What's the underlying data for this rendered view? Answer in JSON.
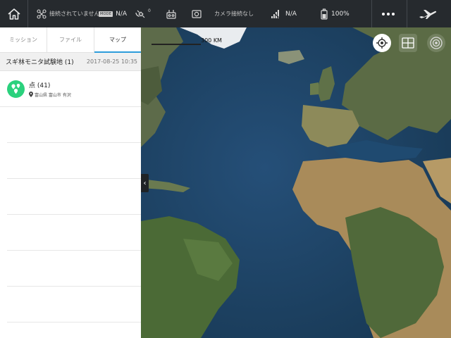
{
  "topbar": {
    "aircraft_status": "接続されていません",
    "flight_mode": "N/A",
    "mode_badge": "MODE",
    "gps_count": "0",
    "camera_status": "カメラ接続なし",
    "signal_value": "N/A",
    "battery": "100%"
  },
  "panel": {
    "tabs": [
      {
        "label": "ミッション",
        "active": false
      },
      {
        "label": "ファイル",
        "active": false
      },
      {
        "label": "マップ",
        "active": true
      }
    ],
    "group": {
      "title": "スギ林モニタ試験地 (1)",
      "date": "2017-08-25 10:35"
    },
    "items": [
      {
        "title": "点 (41)",
        "location": "富山県 富山市 有沢"
      }
    ],
    "collapse_glyph": "‹"
  },
  "map": {
    "scale_label": "300 KM"
  },
  "colors": {
    "accent": "#2d9cdb",
    "point_icon": "#2bd17d",
    "topbar_bg": "#262a2e",
    "ocean": "#20466a"
  }
}
